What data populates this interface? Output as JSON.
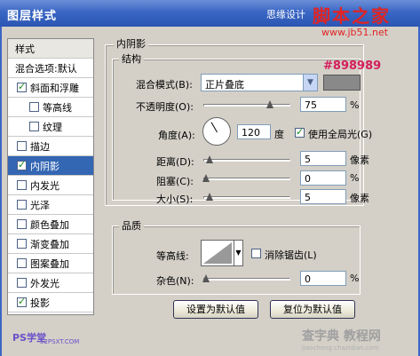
{
  "title": "图层样式",
  "watermark": {
    "site_small": "思缘设计",
    "site_brand": "脚本之家",
    "site_url": "www.jb51.net",
    "bottom_brand": "查字典 教程网",
    "bottom_url": "jiaocheng.chazidian.com",
    "sidebar_brand": "PS学堂",
    "sidebar_url": "52PSXT.COM"
  },
  "sidebar": {
    "items": [
      {
        "label": "样式",
        "checkbox": false,
        "checked": false,
        "selected": false,
        "indent": false
      },
      {
        "label": "混合选项:默认",
        "checkbox": false,
        "checked": false,
        "selected": false,
        "indent": false
      },
      {
        "label": "斜面和浮雕",
        "checkbox": true,
        "checked": true,
        "selected": false,
        "indent": false
      },
      {
        "label": "等高线",
        "checkbox": true,
        "checked": false,
        "selected": false,
        "indent": true
      },
      {
        "label": "纹理",
        "checkbox": true,
        "checked": false,
        "selected": false,
        "indent": true
      },
      {
        "label": "描边",
        "checkbox": true,
        "checked": false,
        "selected": false,
        "indent": false
      },
      {
        "label": "内阴影",
        "checkbox": true,
        "checked": true,
        "selected": true,
        "indent": false
      },
      {
        "label": "内发光",
        "checkbox": true,
        "checked": false,
        "selected": false,
        "indent": false
      },
      {
        "label": "光泽",
        "checkbox": true,
        "checked": false,
        "selected": false,
        "indent": false
      },
      {
        "label": "颜色叠加",
        "checkbox": true,
        "checked": false,
        "selected": false,
        "indent": false
      },
      {
        "label": "渐变叠加",
        "checkbox": true,
        "checked": false,
        "selected": false,
        "indent": false
      },
      {
        "label": "图案叠加",
        "checkbox": true,
        "checked": false,
        "selected": false,
        "indent": false
      },
      {
        "label": "外发光",
        "checkbox": true,
        "checked": false,
        "selected": false,
        "indent": false
      },
      {
        "label": "投影",
        "checkbox": true,
        "checked": true,
        "selected": false,
        "indent": false
      }
    ]
  },
  "panel": {
    "title": "内阴影",
    "structure": {
      "title": "结构",
      "blend_mode_label": "混合模式(B):",
      "blend_mode_value": "正片叠底",
      "color_hex": "#898989",
      "opacity_label": "不透明度(O):",
      "opacity_value": "75",
      "opacity_fraction": 0.75,
      "percent": "%",
      "angle_label": "角度(A):",
      "angle_value": "120",
      "angle_unit": "度",
      "global_light_label": "使用全局光(G)",
      "global_light_checked": true,
      "distance_label": "距离(D):",
      "distance_value": "5",
      "pixel_unit": "像素",
      "choke_label": "阻塞(C):",
      "choke_value": "0",
      "size_label": "大小(S):",
      "size_value": "5"
    },
    "quality": {
      "title": "品质",
      "contour_label": "等高线:",
      "antialias_label": "消除锯齿(L)",
      "antialias_checked": false,
      "noise_label": "杂色(N):",
      "noise_value": "0"
    },
    "buttons": {
      "set_default": "设置为默认值",
      "reset_default": "复位为默认值"
    }
  },
  "colors": {
    "accent": "#3366b3",
    "shadow_color": "#898989",
    "hex_annotation": "#d41e5b"
  }
}
